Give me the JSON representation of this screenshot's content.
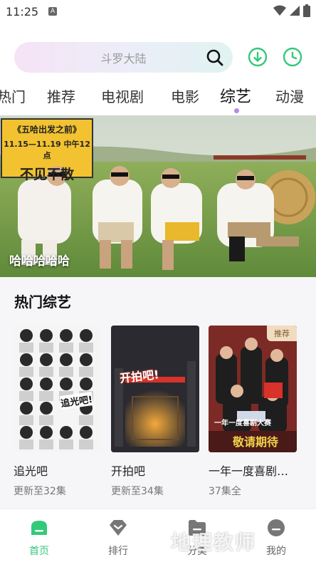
{
  "status_bar": {
    "time": "11:25",
    "notification_letter": "A"
  },
  "search": {
    "placeholder": "斗罗大陆"
  },
  "tabs": [
    {
      "label": "热门"
    },
    {
      "label": "推荐"
    },
    {
      "label": "电视剧"
    },
    {
      "label": "电影"
    },
    {
      "label": "综艺",
      "active": true
    },
    {
      "label": "动漫"
    }
  ],
  "banner": {
    "caption": "哈哈哈哈哈",
    "sign_title": "《五哈出发之前》",
    "sign_date": "11.15—11.19 中午12点",
    "sign_slogan": "不见不散"
  },
  "section": {
    "title": "热门综艺",
    "cards": [
      {
        "title": "追光吧",
        "subtitle": "更新至32集",
        "poster_text": "追光吧!"
      },
      {
        "title": "开拍吧",
        "subtitle": "更新至34集",
        "poster_text": "开拍吧!"
      },
      {
        "title": "一年一度喜剧…",
        "subtitle": "37集全",
        "badge": "推荐",
        "poster_text": "敬请期待",
        "poster_text_top": "一年一度喜剧大赛"
      }
    ]
  },
  "bottom_nav": [
    {
      "label": "首页",
      "icon": "home-icon",
      "active": true
    },
    {
      "label": "排行",
      "icon": "ranking-icon"
    },
    {
      "label": "分类",
      "icon": "category-icon"
    },
    {
      "label": "我的",
      "icon": "profile-icon"
    }
  ],
  "watermark": "地理教师",
  "colors": {
    "accent": "#34c97a",
    "tab_dot": "#b48ce6",
    "badge_bg": "#f2dcc0"
  }
}
